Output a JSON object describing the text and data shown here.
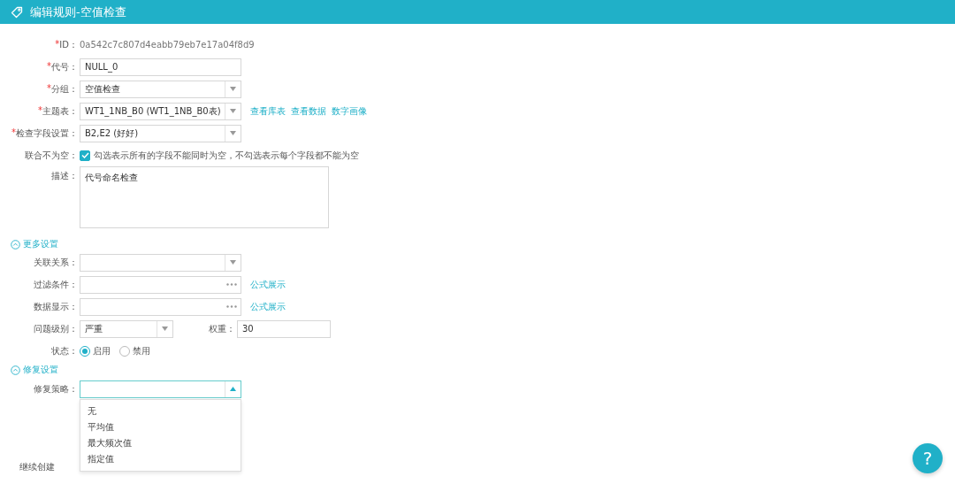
{
  "header": {
    "title": "编辑规则-空值检查"
  },
  "fields": [
    {
      "kind": "static",
      "label": "ID：",
      "mark": "*",
      "value": "0a542c7c807d4eabb79eb7e17a04f8d9"
    },
    {
      "kind": "input",
      "label": "代号：",
      "mark": "*",
      "value": "NULL_0"
    },
    {
      "kind": "select",
      "label": "分组：",
      "mark": "*",
      "value": "空值检查"
    },
    {
      "kind": "select",
      "label": "主题表：",
      "mark": "*",
      "value": "WT1_1NB_B0 (WT1_1NB_B0表)",
      "links": [
        "查看库表",
        "查看数据",
        "数字画像"
      ]
    },
    {
      "kind": "select",
      "label": "检查字段设置：",
      "mark": "*",
      "value": "B2,E2 (好好)"
    },
    {
      "kind": "checkbox",
      "label": "联合不为空：",
      "checked": true,
      "text": "勾选表示所有的字段不能同时为空，不勾选表示每个字段都不能为空"
    },
    {
      "kind": "textarea",
      "label": "描述：",
      "value": "代号命名检查"
    }
  ],
  "sections": [
    {
      "title": "更多设置",
      "expanded": true,
      "fields": [
        {
          "kind": "select",
          "label": "关联关系："
        },
        {
          "kind": "formula",
          "label": "过滤条件：",
          "links": [
            "公式展示"
          ]
        },
        {
          "kind": "formula",
          "label": "数据显示：",
          "links": [
            "公式展示"
          ]
        },
        {
          "kind": "pair",
          "label": "问题级别：",
          "value": "严重",
          "label2": "权重：",
          "value2": "30"
        },
        {
          "kind": "radio",
          "label": "状态：",
          "options": [
            {
              "label": "启用",
              "selected": true
            },
            {
              "label": "禁用",
              "selected": false
            }
          ]
        }
      ]
    },
    {
      "title": "修复设置",
      "expanded": true,
      "fields": [
        {
          "kind": "select",
          "label": "修复策略：",
          "open": true,
          "options": [
            "无",
            "平均值",
            "最大频次值",
            "指定值"
          ]
        }
      ]
    }
  ],
  "continue_label": "继续创建",
  "help_button": "?"
}
